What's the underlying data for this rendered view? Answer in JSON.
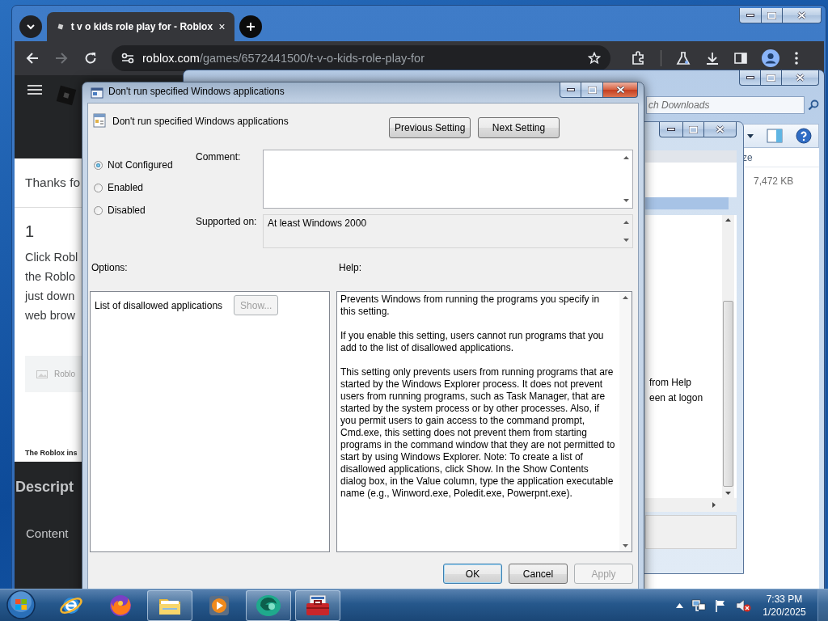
{
  "browser": {
    "tabs": [
      {
        "title": "t v o kids role play for - Roblox",
        "selected": true
      }
    ],
    "forward_enabled": false,
    "url_host": "roblox.com",
    "url_path": "/games/6572441500/t-v-o-kids-role-play-for",
    "page": {
      "heading": "Thanks fo",
      "step_number": "1",
      "step_lines": [
        "Click Robl",
        "the Roblo",
        "just down",
        "web brow"
      ],
      "download_label": "Roblo",
      "footnote": "The Roblox ins",
      "section_heading": "Descript",
      "content_label": "Content"
    }
  },
  "explorer": {
    "search_placeholder": "ch Downloads",
    "column_header": "ze",
    "file_size": "7,472 KB"
  },
  "editor": {
    "lines": [
      "from Help",
      "een at logon"
    ]
  },
  "dialog": {
    "title": "Don't run specified Windows applications",
    "setting_name": "Don't run specified Windows applications",
    "nav_buttons": [
      "Previous Setting",
      "Next Setting"
    ],
    "states": [
      {
        "label": "Not Configured",
        "selected": true
      },
      {
        "label": "Enabled",
        "selected": false
      },
      {
        "label": "Disabled",
        "selected": false
      }
    ],
    "comment_label": "Comment:",
    "supported_label": "Supported on:",
    "supported_value": "At least Windows 2000",
    "options_label": "Options:",
    "help_label": "Help:",
    "option": {
      "label": "List of disallowed applications",
      "button": "Show...",
      "button_disabled": true
    },
    "help_paragraphs": [
      "Prevents Windows from running the programs you specify in this setting.",
      "If you enable this setting, users cannot run programs that you add to the list of disallowed applications.",
      "This setting only prevents users from running programs that are started by the Windows Explorer process. It does not prevent users from running programs, such as Task Manager, that are started by the system process or by other processes. Also, if you permit users to gain access to the command prompt, Cmd.exe, this setting does not prevent them from starting programs in the command window that they are not permitted to start by using Windows Explorer. Note: To create a list of disallowed applications, click Show. In the Show Contents dialog box, in the Value column, type the application executable name (e.g., Winword.exe, Poledit.exe, Powerpnt.exe)."
    ],
    "buttons": [
      {
        "label": "OK",
        "disabled": false,
        "default": true
      },
      {
        "label": "Cancel",
        "disabled": false,
        "default": false
      },
      {
        "label": "Apply",
        "disabled": true,
        "default": false
      }
    ]
  },
  "taskbar": {
    "apps": [
      {
        "kind": "ie",
        "open": false
      },
      {
        "kind": "firefox",
        "open": false
      },
      {
        "kind": "folder",
        "open": true
      },
      {
        "kind": "media",
        "open": false
      },
      {
        "kind": "disc",
        "open": true
      },
      {
        "kind": "toolbox",
        "open": true
      }
    ],
    "volume_muted": true,
    "time": "7:33 PM",
    "date": "1/20/2025"
  }
}
